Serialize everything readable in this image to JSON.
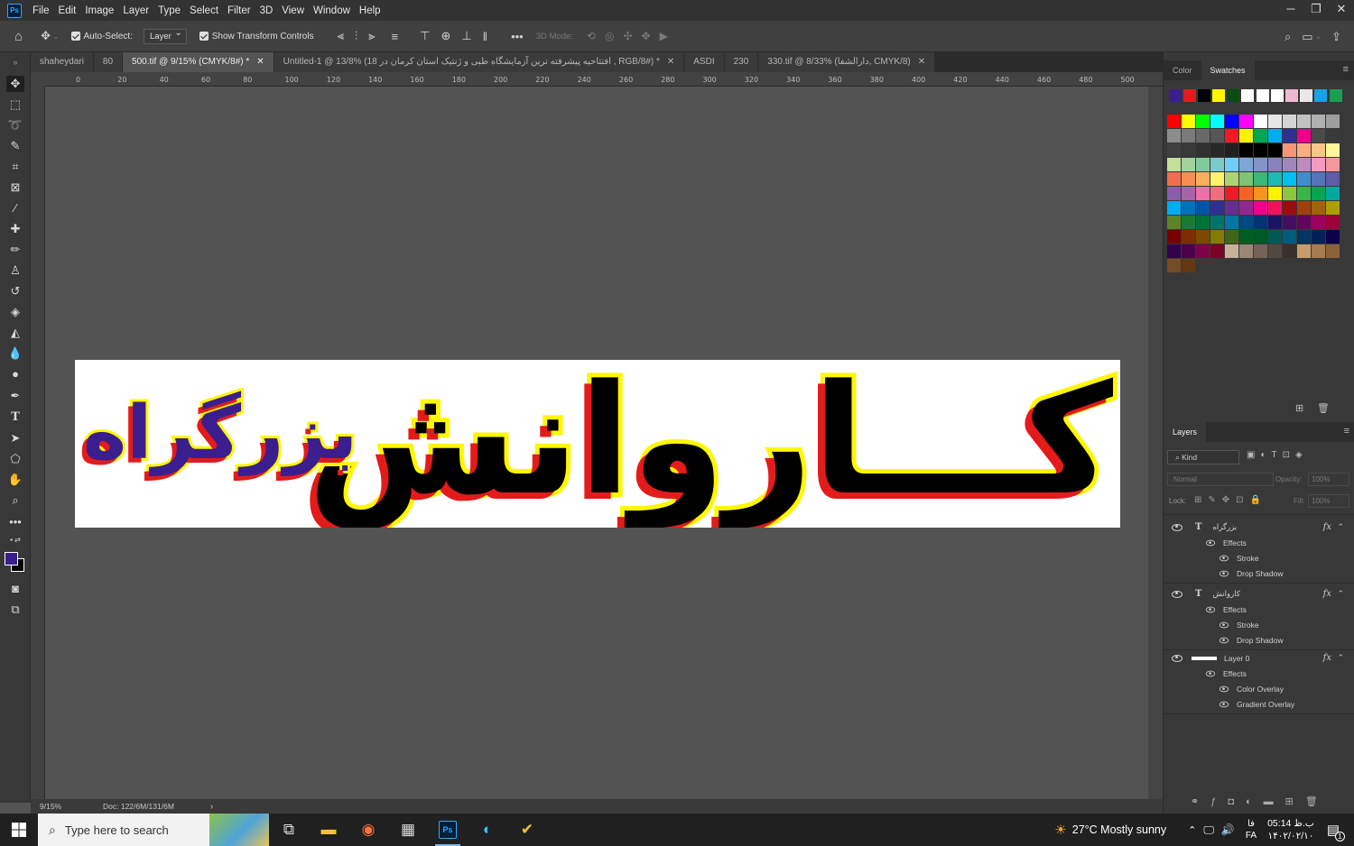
{
  "menubar": {
    "logo": "Ps",
    "items": [
      "File",
      "Edit",
      "Image",
      "Layer",
      "Type",
      "Select",
      "Filter",
      "3D",
      "View",
      "Window",
      "Help"
    ],
    "window_controls": [
      "─",
      "❐",
      "✕"
    ]
  },
  "options": {
    "auto_select_label": "Auto-Select:",
    "auto_select_value": "Layer",
    "transform_label": "Show Transform Controls",
    "mode_3d": "3D Mode:"
  },
  "tabs": [
    {
      "label": "shaheydari",
      "active": false,
      "close": false
    },
    {
      "label": "80",
      "active": false,
      "close": false
    },
    {
      "label": "500.tif @ 9/15% (CMYK/8#) *",
      "active": true,
      "close": true
    },
    {
      "label": "Untitled-1 @ 13/8% (18 افتتاحیه پیشرفته ترین آزمایشگاه طبی و ژنتیک استان کرمان در , RGB/8#) *",
      "active": false,
      "close": true
    },
    {
      "label": "ASDI",
      "active": false,
      "close": false
    },
    {
      "label": "230",
      "active": false,
      "close": false
    },
    {
      "label": "330.tif @ 8/33% (دارالشفا, CMYK/8)",
      "active": false,
      "close": true
    }
  ],
  "ruler": {
    "h_ticks": [
      "0",
      "20",
      "40",
      "60",
      "80",
      "100",
      "120",
      "140",
      "160",
      "180",
      "200",
      "220",
      "240",
      "260",
      "280",
      "300",
      "320",
      "340",
      "360",
      "380",
      "400",
      "420",
      "440",
      "460",
      "480",
      "500"
    ]
  },
  "artwork": {
    "main_text": "کـــاروانش",
    "secondary_text": "بزرگراه"
  },
  "status": {
    "zoom": "9/15%",
    "doc_info": "Doc: 122/6M/131/6M"
  },
  "swatches_panel": {
    "tabs": [
      "Color",
      "Swatches"
    ],
    "recent": [
      "#3b1e8e",
      "#e31b1b",
      "#000000",
      "#fff700",
      "#0b4a10",
      "#ffffff",
      "#ffffff",
      "#ffffff",
      "#f0b8d0",
      "#e8e8e8",
      "#1aa0e8",
      "#1aa050"
    ],
    "rows": [
      [
        "#ff0000",
        "#ffff00",
        "#00ff00",
        "#00ffff",
        "#0000ff",
        "#ff00ff",
        "#ffffff",
        "#e6e6e6",
        "#d4d4d4",
        "#c2c2c2",
        "#b0b0b0",
        "#9e9e9e"
      ],
      [
        "#8c8c8c",
        "#7a7a7a",
        "#686868",
        "#565656",
        "#ed1c24",
        "#fff200",
        "#00a651",
        "#00aeef",
        "#2e3192",
        "#ec008c",
        "#4a4a4a",
        "#3a3a3a"
      ],
      [
        "#404040",
        "#383838",
        "#303030",
        "#282828",
        "#202020",
        "#000000",
        "#000000",
        "#000000",
        "#f69679",
        "#f9ad81",
        "#fdc689",
        "#fff79a"
      ],
      [
        "#c4df9b",
        "#a3d39c",
        "#82ca9c",
        "#7accc8",
        "#6dcff6",
        "#7da7d9",
        "#8393ca",
        "#8781bd",
        "#a186be",
        "#bd8cbf",
        "#f49ac2",
        "#f5989d"
      ],
      [
        "#f26c4f",
        "#f68e56",
        "#fbaf5d",
        "#fff467",
        "#acd373",
        "#7cc576",
        "#3cb878",
        "#1cbbb4",
        "#00bff3",
        "#438ccb",
        "#5674b9",
        "#605ca8"
      ],
      [
        "#855fa8",
        "#a864a8",
        "#f06eaa",
        "#f26d7d",
        "#ed1c24",
        "#f26522",
        "#f7941d",
        "#fff200",
        "#8dc63f",
        "#39b54a",
        "#00a651",
        "#00a99d"
      ],
      [
        "#00aeef",
        "#0072bc",
        "#0054a6",
        "#2e3192",
        "#662d91",
        "#92278f",
        "#ec008c",
        "#ed145b",
        "#9e0b0f",
        "#a0410d",
        "#a3620a",
        "#aba000"
      ],
      [
        "#598527",
        "#1a7b30",
        "#007236",
        "#00746b",
        "#0076a3",
        "#004a80",
        "#003471",
        "#1b1464",
        "#440e62",
        "#630460",
        "#9e005d",
        "#9e0039"
      ],
      [
        "#790000",
        "#7b2e00",
        "#7d4900",
        "#827b00",
        "#406618",
        "#005e20",
        "#005826",
        "#005952",
        "#005b7f",
        "#003663",
        "#002157",
        "#0d004c"
      ],
      [
        "#32004b",
        "#4b0049",
        "#7b0046",
        "#7a0026",
        "#c7b299",
        "#998675",
        "#736357",
        "#534741",
        "#37302b",
        "#c69c6d",
        "#a67c52",
        "#8c6239"
      ],
      [
        "#754c24",
        "#603913"
      ]
    ]
  },
  "layers_panel": {
    "title": "Layers",
    "filter": "Kind",
    "blend_mode": "Normal",
    "opacity_label": "Opacity:",
    "opacity_value": "100%",
    "lock_label": "Lock:",
    "fill_label": "Fill:",
    "fill_value": "100%",
    "layers": [
      {
        "name": "بزرگراه",
        "kind": "T",
        "effects_label": "Effects",
        "effects": [
          "Stroke",
          "Drop Shadow"
        ]
      },
      {
        "name": "کاروانش",
        "kind": "T",
        "effects_label": "Effects",
        "effects": [
          "Stroke",
          "Drop Shadow"
        ]
      },
      {
        "name": "Layer 0",
        "kind": "pixel",
        "effects_label": "Effects",
        "effects": [
          "Color Overlay",
          "Gradient Overlay"
        ]
      }
    ]
  },
  "taskbar": {
    "search_placeholder": "Type here to search",
    "weather": "27°C  Mostly sunny",
    "lang": "FA",
    "lang2": "فا",
    "time": "05:14 ب.ظ",
    "date": "۱۴۰۲/۰۲/۱۰",
    "notif_count": "1"
  }
}
